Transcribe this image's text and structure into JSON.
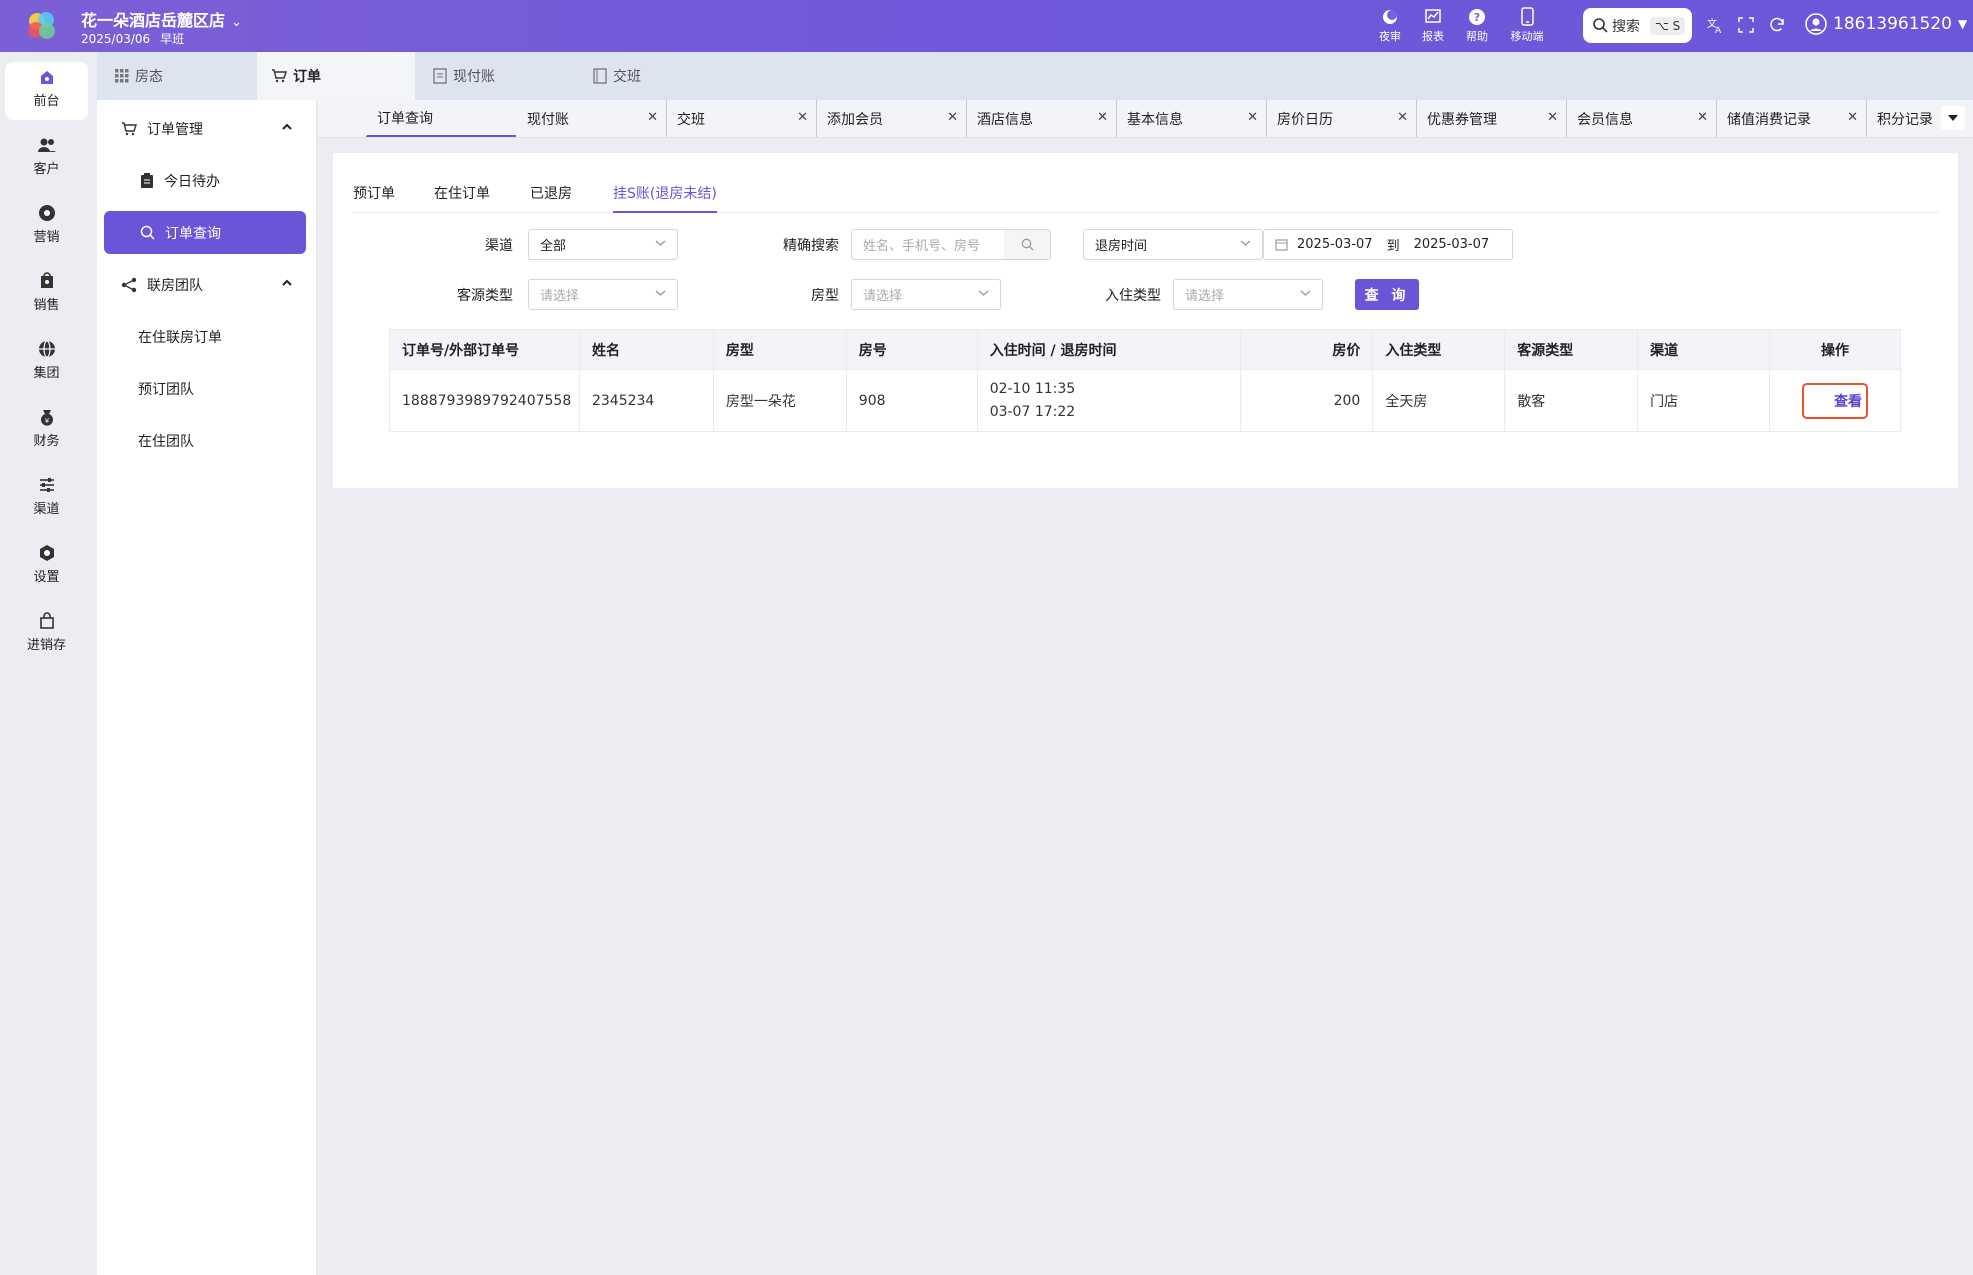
{
  "header": {
    "hotel_name": "花一朵酒店岳麓区店",
    "date": "2025/03/06",
    "shift": "早班",
    "tools": [
      {
        "label": "夜审",
        "icon": "moon-icon"
      },
      {
        "label": "报表",
        "icon": "chart-icon"
      },
      {
        "label": "帮助",
        "icon": "help-icon"
      },
      {
        "label": "移动端",
        "icon": "mobile-icon"
      }
    ],
    "search_label": "搜索",
    "search_shortcut": "⌥ S",
    "user": "18613961520"
  },
  "rail": [
    {
      "label": "前台",
      "icon": "front-desk-icon"
    },
    {
      "label": "客户",
      "icon": "customers-icon"
    },
    {
      "label": "营销",
      "icon": "marketing-icon"
    },
    {
      "label": "销售",
      "icon": "sales-icon"
    },
    {
      "label": "集团",
      "icon": "globe-icon"
    },
    {
      "label": "财务",
      "icon": "finance-icon"
    },
    {
      "label": "渠道",
      "icon": "sliders-icon"
    },
    {
      "label": "设置",
      "icon": "settings-icon"
    },
    {
      "label": "进销存",
      "icon": "inventory-icon"
    }
  ],
  "module_tabs": [
    "房态",
    "订单",
    "现付账",
    "交班"
  ],
  "subnav": {
    "group1": "订单管理",
    "items1": [
      "今日待办",
      "订单查询"
    ],
    "group2": "联房团队",
    "items2": [
      "在住联房订单",
      "预订团队",
      "在住团队"
    ]
  },
  "page_tabs": [
    "订单查询",
    "现付账",
    "交班",
    "添加会员",
    "酒店信息",
    "基本信息",
    "房价日历",
    "优惠券管理",
    "会员信息",
    "储值消费记录",
    "积分记录"
  ],
  "status_tabs": [
    "预订单",
    "在住订单",
    "已退房",
    "挂S账(退房未结)"
  ],
  "filters": {
    "channel_label": "渠道",
    "channel_value": "全部",
    "exact_search_label": "精确搜索",
    "exact_search_placeholder": "姓名、手机号、房号",
    "time_type_value": "退房时间",
    "date_from": "2025-03-07",
    "date_to_sep": "到",
    "date_to": "2025-03-07",
    "source_type_label": "客源类型",
    "source_type_placeholder": "请选择",
    "room_type_label": "房型",
    "room_type_placeholder": "请选择",
    "checkin_type_label": "入住类型",
    "checkin_type_placeholder": "请选择",
    "query_button": "查 询"
  },
  "table": {
    "headers": [
      "订单号/外部订单号",
      "姓名",
      "房型",
      "房号",
      "入住时间 / 退房时间",
      "房价",
      "入住类型",
      "客源类型",
      "渠道",
      "操作"
    ],
    "rows": [
      {
        "order_no": "1888793989792407558",
        "name": "2345234",
        "room_type": "房型一朵花",
        "room_no": "908",
        "checkin": "02-10 11:35",
        "checkout": "03-07 17:22",
        "price": "200",
        "checkin_type": "全天房",
        "source_type": "散客",
        "channel": "门店",
        "action": "查看"
      }
    ]
  },
  "colors": {
    "accent": "#6a55d8",
    "highlight": "#e8522c"
  }
}
